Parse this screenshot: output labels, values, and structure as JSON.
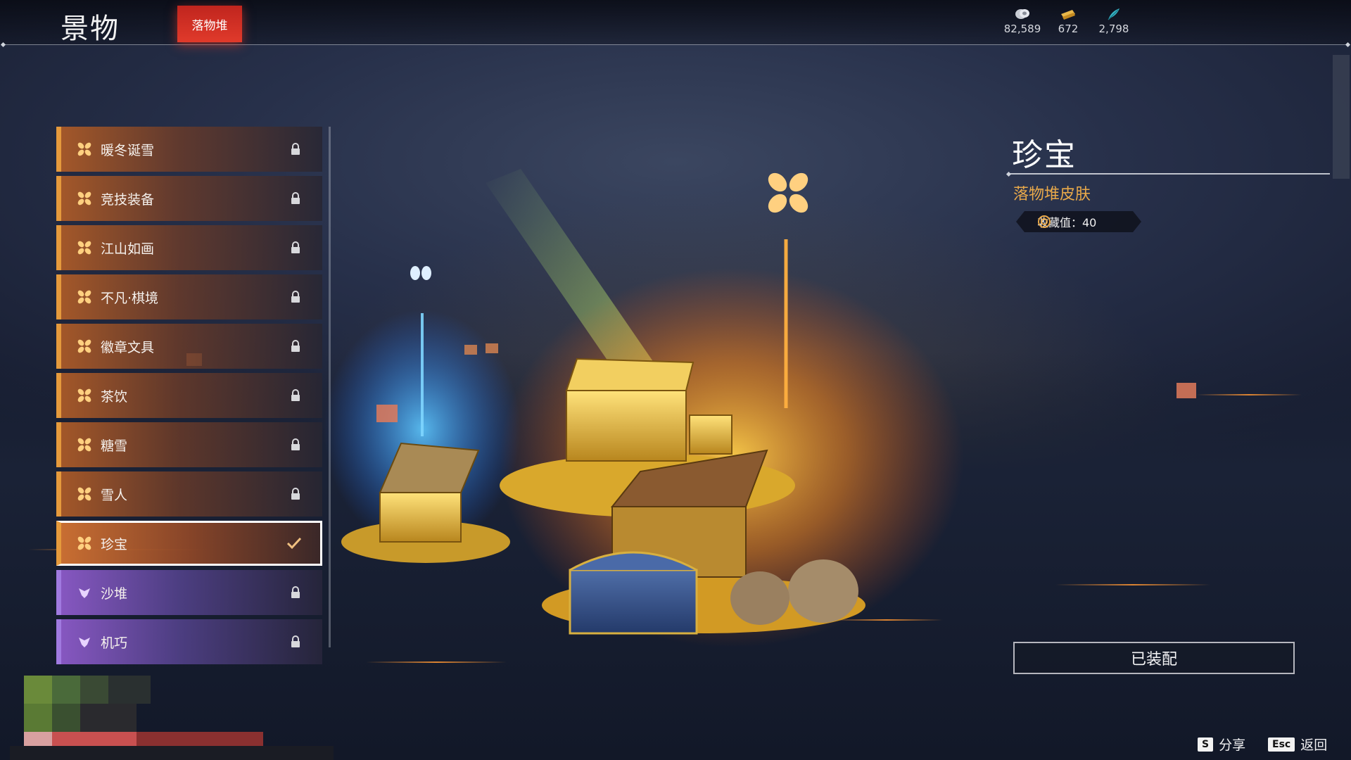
{
  "header": {
    "title": "景物",
    "active_tab": "落物堆"
  },
  "currencies": [
    {
      "icon": "silver-coin-icon",
      "value": "82,589"
    },
    {
      "icon": "gold-ticket-icon",
      "value": "672"
    },
    {
      "icon": "feather-icon",
      "value": "2,798"
    }
  ],
  "list": {
    "items": [
      {
        "label": "暖冬诞雪",
        "rarity": "orange-flower-icon",
        "state": "locked"
      },
      {
        "label": "竞技装备",
        "rarity": "orange-flower-icon",
        "state": "locked"
      },
      {
        "label": "江山如画",
        "rarity": "orange-flower-icon",
        "state": "locked"
      },
      {
        "label": "不凡·棋境",
        "rarity": "orange-flower-icon",
        "state": "locked"
      },
      {
        "label": "徽章文具",
        "rarity": "orange-flower-icon",
        "state": "locked"
      },
      {
        "label": "茶饮",
        "rarity": "orange-flower-icon",
        "state": "locked"
      },
      {
        "label": "糖雪",
        "rarity": "orange-flower-icon",
        "state": "locked"
      },
      {
        "label": "雪人",
        "rarity": "orange-flower-icon",
        "state": "locked"
      },
      {
        "label": "珍宝",
        "rarity": "orange-flower-icon",
        "state": "equipped"
      },
      {
        "label": "沙堆",
        "rarity": "purple-flower-icon",
        "state": "locked"
      },
      {
        "label": "机巧",
        "rarity": "purple-flower-icon",
        "state": "locked"
      }
    ]
  },
  "detail": {
    "title": "珍宝",
    "subtitle": "落物堆皮肤",
    "collection_label": "收藏值：40",
    "equip_button": "已装配"
  },
  "hints": {
    "share_key": "S",
    "share_label": "分享",
    "back_key": "Esc",
    "back_label": "返回"
  },
  "colors": {
    "accent_red": "#e03a2b",
    "orange_rarity": "#e59a3c",
    "purple_rarity": "#a07ae0",
    "gold_text": "#e9a94a"
  }
}
